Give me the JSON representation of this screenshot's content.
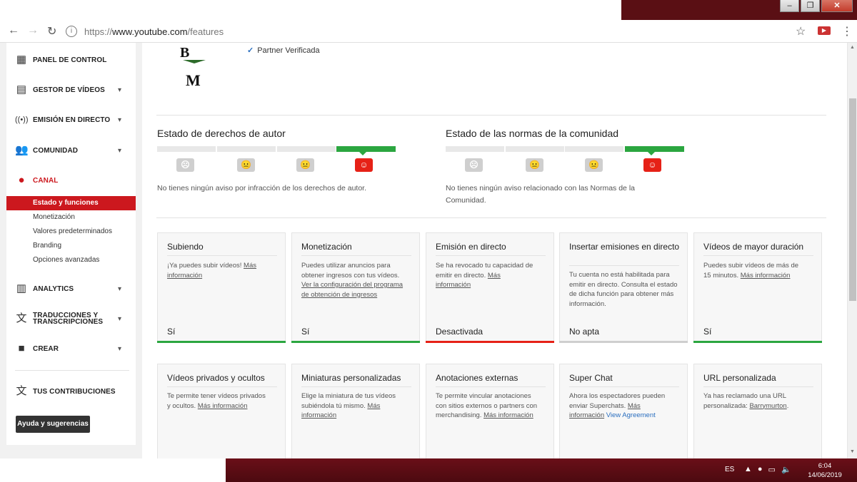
{
  "browser": {
    "url_prefix": "https://",
    "url_domain": "www.youtube.com",
    "url_path": "/features"
  },
  "sidebar": {
    "items": [
      {
        "label": "PANEL DE CONTROL"
      },
      {
        "label": "GESTOR DE VÍDEOS"
      },
      {
        "label": "EMISIÓN EN DIRECTO"
      },
      {
        "label": "COMUNIDAD"
      },
      {
        "label": "CANAL"
      },
      {
        "label": "ANALYTICS"
      },
      {
        "label1": "TRADUCCIONES Y",
        "label2": "TRANSCRIPCIONES"
      },
      {
        "label": "CREAR"
      },
      {
        "label": "TUS CONTRIBUCIONES"
      }
    ],
    "canal_sub": [
      {
        "label": "Estado y funciones"
      },
      {
        "label": "Monetización"
      },
      {
        "label": "Valores predeterminados"
      },
      {
        "label": "Branding"
      },
      {
        "label": "Opciones avanzadas"
      }
    ],
    "help_button": "Ayuda y sugerencias"
  },
  "header": {
    "partner": "Partner Verificada"
  },
  "copyright": {
    "title": "Estado de derechos de autor",
    "text": "No tienes ningún aviso por infracción de los derechos de autor.",
    "level": 4
  },
  "community": {
    "title": "Estado de las normas de la comunidad",
    "text1": "No tienes ningún aviso relacionado con las Normas de la",
    "text2": "Comunidad.",
    "level": 4
  },
  "cards_row1": [
    {
      "title": "Subiendo",
      "desc": "¡Ya puedes subir vídeos!",
      "link1": "Más",
      "link2": "información",
      "status": "Sí",
      "bar_color": "#2ba640"
    },
    {
      "title": "Monetización",
      "desc1": "Puedes utilizar anuncios para",
      "desc2": "obtener ingresos con tus vídeos.",
      "link1": "Ver la configuración del programa",
      "link2": "de obtención de ingresos",
      "status": "Sí",
      "bar_color": "#2ba640"
    },
    {
      "title": "Emisión en directo",
      "desc1": "Se ha revocado tu capacidad de",
      "desc2": "emitir en directo.",
      "link1": "Más",
      "link2": "información",
      "status": "Desactivada",
      "bar_color": "#e62117"
    },
    {
      "title": "Insertar emisiones en directo",
      "desc": "Tu cuenta no está habilitada para emitir en directo. Consulta el estado de dicha función para obtener más información.",
      "status": "No apta",
      "bar_color": "#cfcfcf"
    },
    {
      "title": "Vídeos de mayor duración",
      "desc1": "Puedes subir vídeos de más de",
      "desc2": "15 minutos.",
      "link": "Más información",
      "status": "Sí",
      "bar_color": "#2ba640"
    }
  ],
  "cards_row2": [
    {
      "title": "Vídeos privados y ocultos",
      "desc1": "Te permite tener vídeos privados",
      "desc2": "y ocultos.",
      "link": "Más información"
    },
    {
      "title": "Miniaturas personalizadas",
      "desc1": "Elige la miniatura de tus vídeos",
      "desc2": "subiéndola tú mismo.",
      "link1": "Más",
      "link2": "información"
    },
    {
      "title": "Anotaciones externas",
      "desc1": "Te permite vincular anotaciones",
      "desc2": "con sitios externos o partners con",
      "desc3": "merchandising.",
      "link": "Más información"
    },
    {
      "title": "Super Chat",
      "desc1": "Ahora los espectadores pueden",
      "desc2": "enviar Superchats.",
      "link1": "Más",
      "link2": "información",
      "link_blue": "View Agreement"
    },
    {
      "title": "URL personalizada",
      "desc1": "Ya has reclamado una URL",
      "desc2": "personalizada:",
      "link": "Barrymurton"
    }
  ],
  "taskbar": {
    "lang": "ES",
    "time": "6:04",
    "date": "14/06/2019"
  },
  "colors": {
    "accent_red": "#cc181e",
    "ok_green": "#2ba640",
    "bad_red": "#e62117"
  }
}
